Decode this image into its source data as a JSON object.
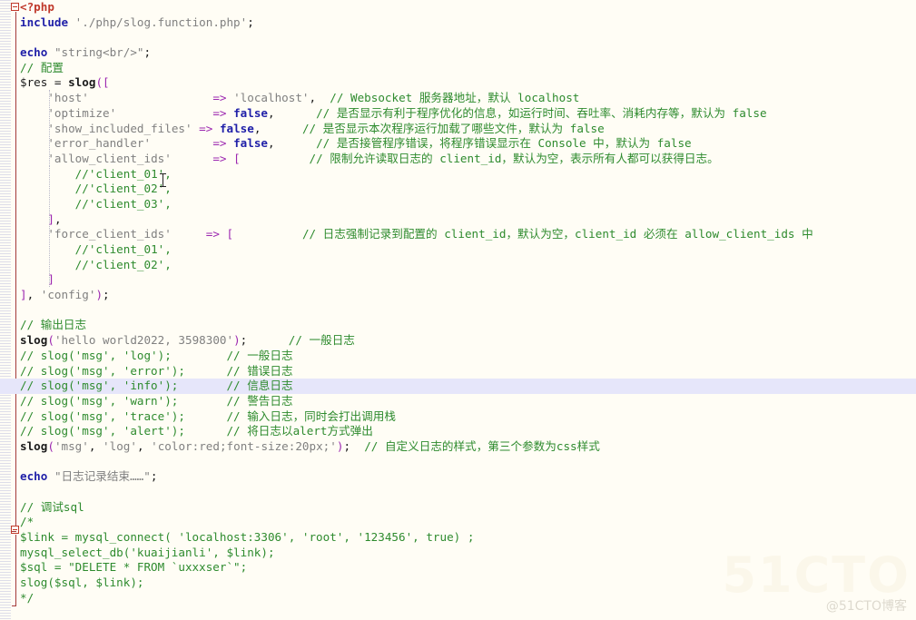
{
  "editor": {
    "language": "PHP",
    "colors": {
      "background": "#FFFDF5",
      "current_line_highlight": "#E6E6FA",
      "keyword": "#1F1FA8",
      "string": "#808080",
      "comment": "#2E8B2E",
      "punctuation": "#9C27B0",
      "php_tag": "#C0392B",
      "fold_rail": "#A33A3A",
      "indent_guide": "#B9B9C9"
    },
    "fold_markers": [
      {
        "name": "php-block-fold",
        "state": "expanded",
        "line": 1
      },
      {
        "name": "comment-block-fold",
        "state": "expanded",
        "line": 36
      }
    ],
    "watermark_large": "51CTO",
    "watermark_small": "@51CTO博客"
  },
  "lines": [
    {
      "n": 1,
      "indent": 0,
      "hl": false,
      "tokens": [
        {
          "c": "tag",
          "t": "<?php"
        }
      ]
    },
    {
      "n": 2,
      "indent": 0,
      "hl": false,
      "tokens": [
        {
          "c": "kw",
          "t": "include"
        },
        {
          "c": "op",
          "t": " "
        },
        {
          "c": "str",
          "t": "'./php/slog.function.php'"
        },
        {
          "c": "op",
          "t": ";"
        }
      ]
    },
    {
      "n": 3,
      "indent": 0,
      "hl": false,
      "tokens": []
    },
    {
      "n": 4,
      "indent": 0,
      "hl": false,
      "tokens": [
        {
          "c": "kw",
          "t": "echo"
        },
        {
          "c": "op",
          "t": " "
        },
        {
          "c": "str",
          "t": "\"string<br/>\""
        },
        {
          "c": "op",
          "t": ";"
        }
      ]
    },
    {
      "n": 5,
      "indent": 0,
      "hl": false,
      "tokens": [
        {
          "c": "cmt",
          "t": "// 配置"
        }
      ]
    },
    {
      "n": 6,
      "indent": 0,
      "hl": false,
      "tokens": [
        {
          "c": "var",
          "t": "$res"
        },
        {
          "c": "op",
          "t": " = "
        },
        {
          "c": "fn",
          "t": "slog"
        },
        {
          "c": "pun",
          "t": "(["
        }
      ]
    },
    {
      "n": 7,
      "indent": 1,
      "hl": false,
      "tokens": [
        {
          "c": "str",
          "t": "'host'"
        },
        {
          "c": "op",
          "t": "                  "
        },
        {
          "c": "pun",
          "t": "=>"
        },
        {
          "c": "op",
          "t": " "
        },
        {
          "c": "str",
          "t": "'localhost'"
        },
        {
          "c": "op",
          "t": ",  "
        },
        {
          "c": "cmt",
          "t": "// Websocket 服务器地址，默认 localhost"
        }
      ]
    },
    {
      "n": 8,
      "indent": 1,
      "hl": false,
      "tokens": [
        {
          "c": "str",
          "t": "'optimize'"
        },
        {
          "c": "op",
          "t": "              "
        },
        {
          "c": "pun",
          "t": "=>"
        },
        {
          "c": "op",
          "t": " "
        },
        {
          "c": "kw",
          "t": "false"
        },
        {
          "c": "op",
          "t": ",      "
        },
        {
          "c": "cmt",
          "t": "// 是否显示有利于程序优化的信息，如运行时间、吞吐率、消耗内存等，默认为 false"
        }
      ]
    },
    {
      "n": 9,
      "indent": 1,
      "hl": false,
      "tokens": [
        {
          "c": "str",
          "t": "'show_included_files'"
        },
        {
          "c": "op",
          "t": " "
        },
        {
          "c": "pun",
          "t": "=>"
        },
        {
          "c": "op",
          "t": " "
        },
        {
          "c": "kw",
          "t": "false"
        },
        {
          "c": "op",
          "t": ",      "
        },
        {
          "c": "cmt",
          "t": "// 是否显示本次程序运行加载了哪些文件，默认为 false"
        }
      ]
    },
    {
      "n": 10,
      "indent": 1,
      "hl": false,
      "tokens": [
        {
          "c": "str",
          "t": "'error_handler'"
        },
        {
          "c": "op",
          "t": "         "
        },
        {
          "c": "pun",
          "t": "=>"
        },
        {
          "c": "op",
          "t": " "
        },
        {
          "c": "kw",
          "t": "false"
        },
        {
          "c": "op",
          "t": ",      "
        },
        {
          "c": "cmt",
          "t": "// 是否接管程序错误，将程序错误显示在 Console 中，默认为 false"
        }
      ]
    },
    {
      "n": 11,
      "indent": 1,
      "hl": false,
      "tokens": [
        {
          "c": "str",
          "t": "'allow_client_ids'"
        },
        {
          "c": "op",
          "t": "      "
        },
        {
          "c": "pun",
          "t": "=>"
        },
        {
          "c": "op",
          "t": " "
        },
        {
          "c": "pun",
          "t": "["
        },
        {
          "c": "op",
          "t": "          "
        },
        {
          "c": "cmt",
          "t": "// 限制允许读取日志的 client_id，默认为空，表示所有人都可以获得日志。"
        }
      ]
    },
    {
      "n": 12,
      "indent": 2,
      "hl": false,
      "tokens": [
        {
          "c": "cmt",
          "t": "//'client_01',"
        }
      ]
    },
    {
      "n": 13,
      "indent": 2,
      "hl": false,
      "tokens": [
        {
          "c": "cmt",
          "t": "//'client_02',"
        }
      ]
    },
    {
      "n": 14,
      "indent": 2,
      "hl": false,
      "tokens": [
        {
          "c": "cmt",
          "t": "//'client_03',"
        }
      ]
    },
    {
      "n": 15,
      "indent": 1,
      "hl": false,
      "tokens": [
        {
          "c": "pun",
          "t": "]"
        },
        {
          "c": "op",
          "t": ","
        }
      ]
    },
    {
      "n": 16,
      "indent": 1,
      "hl": false,
      "tokens": [
        {
          "c": "str",
          "t": "'force_client_ids'"
        },
        {
          "c": "op",
          "t": "     "
        },
        {
          "c": "pun",
          "t": "=>"
        },
        {
          "c": "op",
          "t": " "
        },
        {
          "c": "pun",
          "t": "["
        },
        {
          "c": "op",
          "t": "          "
        },
        {
          "c": "cmt",
          "t": "// 日志强制记录到配置的 client_id，默认为空，client_id 必须在 allow_client_ids 中"
        }
      ]
    },
    {
      "n": 17,
      "indent": 2,
      "hl": false,
      "tokens": [
        {
          "c": "cmt",
          "t": "//'client_01',"
        }
      ]
    },
    {
      "n": 18,
      "indent": 2,
      "hl": false,
      "tokens": [
        {
          "c": "cmt",
          "t": "//'client_02',"
        }
      ]
    },
    {
      "n": 19,
      "indent": 1,
      "hl": false,
      "tokens": [
        {
          "c": "pun",
          "t": "]"
        }
      ]
    },
    {
      "n": 20,
      "indent": 0,
      "hl": false,
      "tokens": [
        {
          "c": "pun",
          "t": "]"
        },
        {
          "c": "op",
          "t": ", "
        },
        {
          "c": "str",
          "t": "'config'"
        },
        {
          "c": "pun",
          "t": ")"
        },
        {
          "c": "op",
          "t": ";"
        }
      ]
    },
    {
      "n": 21,
      "indent": 0,
      "hl": false,
      "tokens": []
    },
    {
      "n": 22,
      "indent": 0,
      "hl": false,
      "tokens": [
        {
          "c": "cmt",
          "t": "// 输出日志"
        }
      ]
    },
    {
      "n": 23,
      "indent": 0,
      "hl": false,
      "tokens": [
        {
          "c": "fn",
          "t": "slog"
        },
        {
          "c": "pun",
          "t": "("
        },
        {
          "c": "str",
          "t": "'hello world2022, 3598300'"
        },
        {
          "c": "pun",
          "t": ")"
        },
        {
          "c": "op",
          "t": ";"
        },
        {
          "c": "op",
          "t": "      "
        },
        {
          "c": "cmt",
          "t": "// 一般日志"
        }
      ]
    },
    {
      "n": 24,
      "indent": 0,
      "hl": false,
      "tokens": [
        {
          "c": "cmt",
          "t": "// slog('msg', 'log');        // 一般日志"
        }
      ]
    },
    {
      "n": 25,
      "indent": 0,
      "hl": false,
      "tokens": [
        {
          "c": "cmt",
          "t": "// slog('msg', 'error');      // 错误日志"
        }
      ]
    },
    {
      "n": 26,
      "indent": 0,
      "hl": true,
      "tokens": [
        {
          "c": "cmt",
          "t": "// slog('msg', 'info');       // 信息日志"
        }
      ]
    },
    {
      "n": 27,
      "indent": 0,
      "hl": false,
      "tokens": [
        {
          "c": "cmt",
          "t": "// slog('msg', 'warn');       // 警告日志"
        }
      ]
    },
    {
      "n": 28,
      "indent": 0,
      "hl": false,
      "tokens": [
        {
          "c": "cmt",
          "t": "// slog('msg', 'trace');      // 输入日志，同时会打出调用栈"
        }
      ]
    },
    {
      "n": 29,
      "indent": 0,
      "hl": false,
      "tokens": [
        {
          "c": "cmt",
          "t": "// slog('msg', 'alert');      // 将日志以alert方式弹出"
        }
      ]
    },
    {
      "n": 30,
      "indent": 0,
      "hl": false,
      "tokens": [
        {
          "c": "fn",
          "t": "slog"
        },
        {
          "c": "pun",
          "t": "("
        },
        {
          "c": "str",
          "t": "'msg'"
        },
        {
          "c": "op",
          "t": ", "
        },
        {
          "c": "str",
          "t": "'log'"
        },
        {
          "c": "op",
          "t": ", "
        },
        {
          "c": "str",
          "t": "'color:red;font-size:20px;'"
        },
        {
          "c": "pun",
          "t": ")"
        },
        {
          "c": "op",
          "t": ";"
        },
        {
          "c": "op",
          "t": "  "
        },
        {
          "c": "cmt",
          "t": "// 自定义日志的样式，第三个参数为css样式"
        }
      ]
    },
    {
      "n": 31,
      "indent": 0,
      "hl": false,
      "tokens": []
    },
    {
      "n": 32,
      "indent": 0,
      "hl": false,
      "tokens": [
        {
          "c": "kw",
          "t": "echo"
        },
        {
          "c": "op",
          "t": " "
        },
        {
          "c": "str",
          "t": "\"日志记录结束……\""
        },
        {
          "c": "op",
          "t": ";"
        }
      ]
    },
    {
      "n": 33,
      "indent": 0,
      "hl": false,
      "tokens": []
    },
    {
      "n": 34,
      "indent": 0,
      "hl": false,
      "tokens": [
        {
          "c": "cmt",
          "t": "// 调试sql"
        }
      ]
    },
    {
      "n": 35,
      "indent": 0,
      "hl": false,
      "tokens": [
        {
          "c": "cmt",
          "t": "/*"
        }
      ]
    },
    {
      "n": 36,
      "indent": 0,
      "hl": false,
      "tokens": [
        {
          "c": "cmt",
          "t": "$link = mysql_connect( 'localhost:3306', 'root', '123456', true) ;"
        }
      ]
    },
    {
      "n": 37,
      "indent": 0,
      "hl": false,
      "tokens": [
        {
          "c": "cmt",
          "t": "mysql_select_db('kuaijianli', $link);"
        }
      ]
    },
    {
      "n": 38,
      "indent": 0,
      "hl": false,
      "tokens": [
        {
          "c": "cmt",
          "t": "$sql = \"DELETE * FROM `uxxxser`\";"
        }
      ]
    },
    {
      "n": 39,
      "indent": 0,
      "hl": false,
      "tokens": [
        {
          "c": "cmt",
          "t": "slog($sql, $link);"
        }
      ]
    },
    {
      "n": 40,
      "indent": 0,
      "hl": false,
      "tokens": [
        {
          "c": "cmt",
          "t": "*/"
        }
      ]
    }
  ]
}
